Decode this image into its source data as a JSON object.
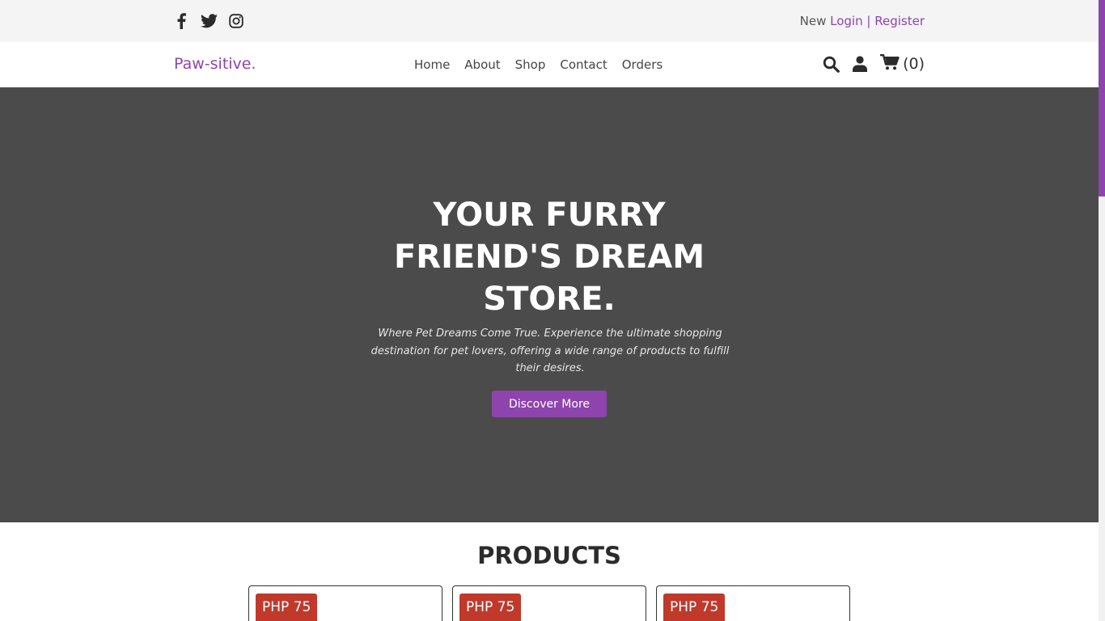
{
  "topbar": {
    "social": [
      "facebook-icon",
      "twitter-icon",
      "instagram-icon"
    ],
    "auth": {
      "prefix": "New",
      "login": "Login",
      "separator": "|",
      "register": "Register"
    }
  },
  "nav": {
    "logo": "Paw-sitive.",
    "items": [
      "Home",
      "About",
      "Shop",
      "Contact",
      "Orders"
    ],
    "icons": [
      "search-icon",
      "user-icon",
      "cart-icon"
    ],
    "cart_count": "(0)"
  },
  "hero": {
    "title": "YOUR FURRY FRIEND'S DREAM STORE.",
    "subtitle": "Where Pet Dreams Come True. Experience the ultimate shopping destination for pet lovers, offering a wide range of products to fulfill their desires.",
    "button": "Discover More"
  },
  "products": {
    "title": "PRODUCTS",
    "items": [
      {
        "price": "PHP 75"
      },
      {
        "price": "PHP 75"
      },
      {
        "price": "PHP 75"
      }
    ]
  },
  "colors": {
    "accent": "#8e44ad",
    "hero_bg": "#4b4b4b",
    "price_bg": "#c0392b"
  }
}
